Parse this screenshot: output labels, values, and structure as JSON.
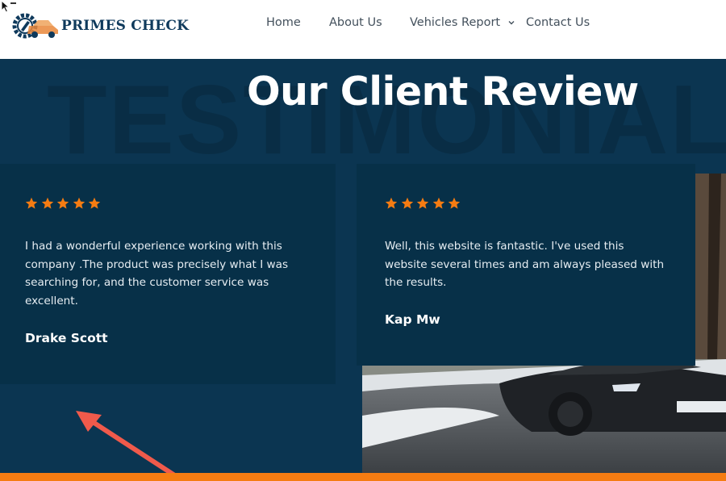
{
  "brand": {
    "name": "PRIMES CHECK",
    "logo_icon": "gear-car-logo",
    "color": "#0f3a5c"
  },
  "nav": {
    "items": [
      {
        "label": "Home"
      },
      {
        "label": "About Us"
      },
      {
        "label": "Vehicles Report",
        "icon": "chevron-down-icon"
      },
      {
        "label": "Contact Us"
      }
    ]
  },
  "testimonials": {
    "background_word": "TESTIMONIAL",
    "title": "Our Client Review",
    "reviews": [
      {
        "rating": 5,
        "text": "I had a wonderful experience working with this company .The product was precisely what I was searching for, and the customer service was excellent.",
        "author": "Drake Scott"
      },
      {
        "rating": 5,
        "text": "Well, this website is fantastic. I've used this website several times and am always pleased with the results.",
        "author": "Kap Mw"
      }
    ]
  },
  "colors": {
    "accent": "#f57c12",
    "section_bg": "#0b3551",
    "card_bg": "#073048",
    "star": "#f57c12",
    "arrow": "#f05a4b"
  }
}
